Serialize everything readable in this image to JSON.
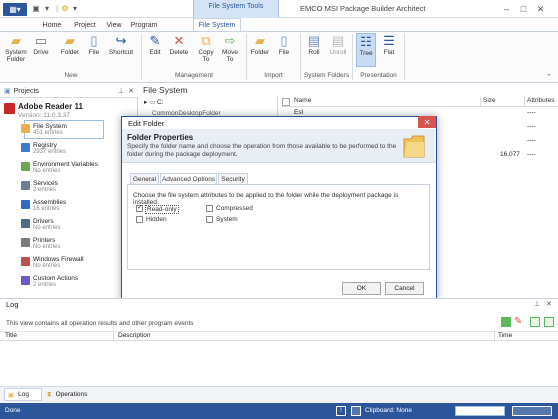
{
  "window": {
    "title": "EMCO MSI Package Builder Architect",
    "context_group": "File System Tools"
  },
  "tabs": [
    "Home",
    "Project",
    "View",
    "Program",
    "File System"
  ],
  "ribbon": {
    "buttons": [
      {
        "label": "System\nFolder",
        "icon": "system-folder-icon"
      },
      {
        "label": "Drive",
        "icon": "drive-icon"
      },
      {
        "label": "Folder",
        "icon": "folder-icon"
      },
      {
        "label": "File",
        "icon": "file-icon"
      },
      {
        "label": "Shortcut",
        "icon": "shortcut-icon"
      },
      {
        "label": "Edit",
        "icon": "pencil-icon"
      },
      {
        "label": "Delete",
        "icon": "delete-icon"
      },
      {
        "label": "Copy\nTo",
        "icon": "copy-icon"
      },
      {
        "label": "Move\nTo",
        "icon": "move-icon"
      },
      {
        "label": "Folder",
        "icon": "import-folder-icon"
      },
      {
        "label": "File",
        "icon": "import-file-icon"
      },
      {
        "label": "Roll",
        "icon": "roll-icon"
      },
      {
        "label": "Unroll",
        "icon": "unroll-icon"
      },
      {
        "label": "Tree",
        "icon": "tree-icon"
      },
      {
        "label": "Flat",
        "icon": "flat-icon"
      }
    ],
    "groups": [
      "New",
      "Management",
      "Import",
      "System Folders",
      "Presentation"
    ]
  },
  "projects": {
    "title": "Projects",
    "app_name": "Adobe Reader 11",
    "app_version": "Version: 11.0.3.37",
    "nodes": [
      {
        "label": "File System",
        "sub": "451 entries",
        "color": "#e8b04a"
      },
      {
        "label": "Registry",
        "sub": "2937 entries",
        "color": "#3d7dc8"
      },
      {
        "label": "Environment Variables",
        "sub": "No entries",
        "color": "#6aa84f"
      },
      {
        "label": "Services",
        "sub": "2 entries",
        "color": "#6d7f94"
      },
      {
        "label": "Assemblies",
        "sub": "16 entries",
        "color": "#2f6bbd"
      },
      {
        "label": "Drivers",
        "sub": "No entries",
        "color": "#4f6b8a"
      },
      {
        "label": "Printers",
        "sub": "No entries",
        "color": "#7a7a7a"
      },
      {
        "label": "Windows Firewall",
        "sub": "No entries",
        "color": "#c0504d"
      },
      {
        "label": "Custom Actions",
        "sub": "2 entries",
        "color": "#6a5acd"
      }
    ]
  },
  "filesystem": {
    "title": "File System",
    "tree": [
      "C:",
      "CommonDesktopFolder"
    ],
    "columns": [
      "Name",
      "Size",
      "Attributes"
    ],
    "rows": [
      {
        "name": "Esl",
        "size": "",
        "attr": "----"
      },
      {
        "name": "",
        "size": "",
        "attr": "----"
      },
      {
        "name": "",
        "size": "",
        "attr": "----"
      },
      {
        "name": "",
        "size": "16,077",
        "attr": "----"
      }
    ]
  },
  "dialog": {
    "title": "Edit Folder",
    "heading": "Folder Properties",
    "description": "Specify the folder name and choose the operation from those available to be performed to the folder during the package deployment.",
    "tabs": [
      "General",
      "Advanced Options",
      "Security"
    ],
    "instruction": "Choose the file system attributes to be applied to the folder while the deployment package is installed.",
    "options": [
      {
        "label": "Read-only",
        "checked": true
      },
      {
        "label": "Compressed",
        "checked": false
      },
      {
        "label": "Hidden",
        "checked": false
      },
      {
        "label": "System",
        "checked": false
      }
    ],
    "ok": "OK",
    "cancel": "Cancel"
  },
  "log": {
    "title": "Log",
    "info": "This view contains all operation results and other program events",
    "columns": [
      "Title",
      "Description",
      "Time"
    ],
    "tabs": [
      "Log",
      "Operations"
    ]
  },
  "status": {
    "left": "Done",
    "clipboard": "Clipboard: None"
  }
}
